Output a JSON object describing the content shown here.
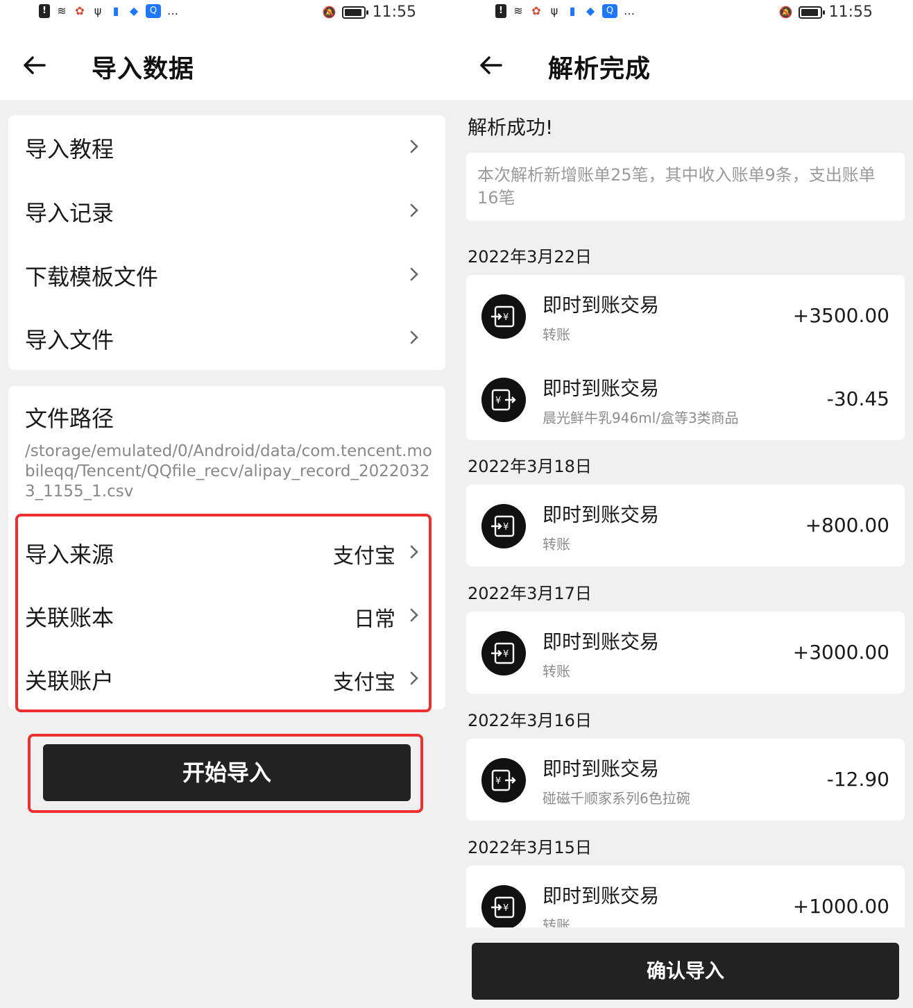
{
  "status_bar": {
    "time": "11:55"
  },
  "left_screen": {
    "title": "导入数据",
    "menu_items": [
      {
        "label": "导入教程"
      },
      {
        "label": "导入记录"
      },
      {
        "label": "下载模板文件"
      },
      {
        "label": "导入文件"
      }
    ],
    "file_path": {
      "label": "文件路径",
      "value": "/storage/emulated/0/Android/data/com.tencent.mobileqq/Tencent/QQfile_recv/alipay_record_20220323_1155_1.csv"
    },
    "settings": [
      {
        "label": "导入来源",
        "value": "支付宝"
      },
      {
        "label": "关联账本",
        "value": "日常"
      },
      {
        "label": "关联账户",
        "value": "支付宝"
      }
    ],
    "start_button": "开始导入"
  },
  "right_screen": {
    "title": "解析完成",
    "success_text": "解析成功!",
    "summary": "本次解析新增账单25笔，其中收入账单9条，支出账单16笔",
    "groups": [
      {
        "date": "2022年3月22日",
        "transactions": [
          {
            "name": "即时到账交易",
            "sub": "转账",
            "amount": "+3500.00",
            "type": "income"
          },
          {
            "name": "即时到账交易",
            "sub": "晨光鲜牛乳946ml/盒等3类商品",
            "amount": "-30.45",
            "type": "expense"
          }
        ]
      },
      {
        "date": "2022年3月18日",
        "transactions": [
          {
            "name": "即时到账交易",
            "sub": "转账",
            "amount": "+800.00",
            "type": "income"
          }
        ]
      },
      {
        "date": "2022年3月17日",
        "transactions": [
          {
            "name": "即时到账交易",
            "sub": "转账",
            "amount": "+3000.00",
            "type": "income"
          }
        ]
      },
      {
        "date": "2022年3月16日",
        "transactions": [
          {
            "name": "即时到账交易",
            "sub": "碰磁千顺家系列6色拉碗",
            "amount": "-12.90",
            "type": "expense"
          }
        ]
      },
      {
        "date": "2022年3月15日",
        "transactions": [
          {
            "name": "即时到账交易",
            "sub": "转账",
            "amount": "+1000.00",
            "type": "income"
          }
        ]
      }
    ],
    "confirm_button": "确认导入"
  }
}
